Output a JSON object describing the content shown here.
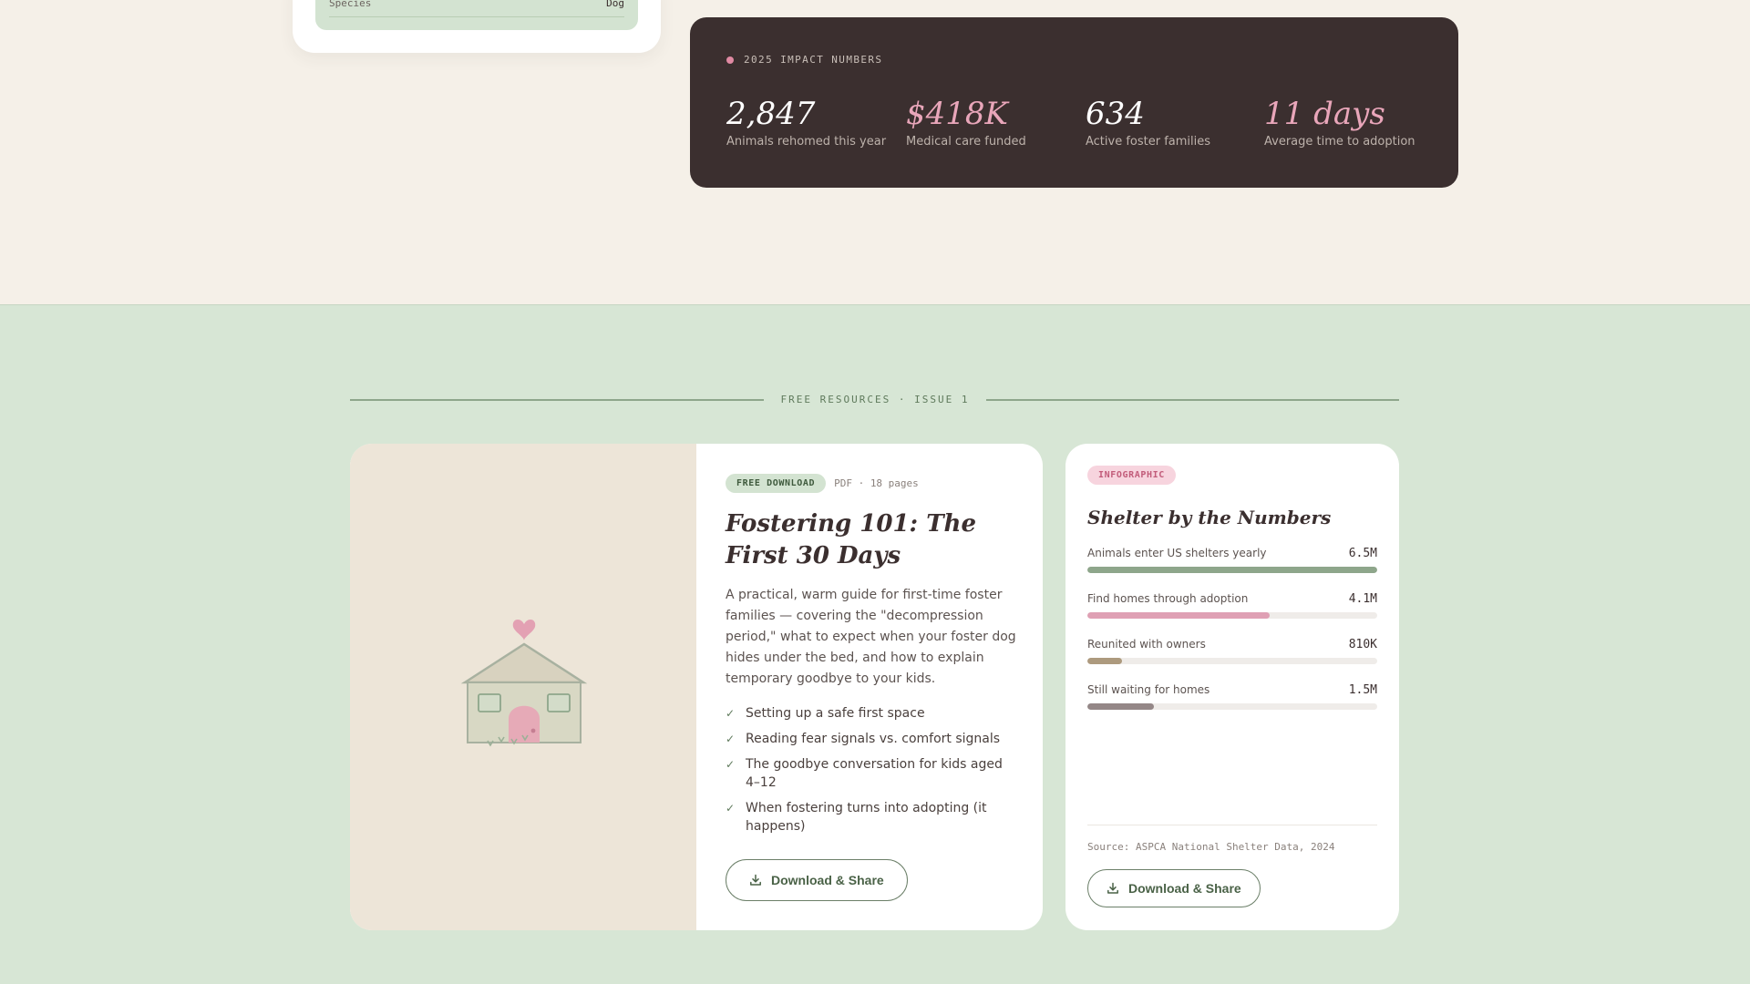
{
  "profile": {
    "species_label": "Species",
    "species_value": "Dog"
  },
  "impact": {
    "heading": "2025 IMPACT NUMBERS",
    "stats": [
      {
        "value": "2,847",
        "label": "Animals rehomed this year",
        "color": "#ffffff"
      },
      {
        "value": "$418K",
        "label": "Medical care funded",
        "color": "#e9a6ba"
      },
      {
        "value": "634",
        "label": "Active foster families",
        "color": "#ffffff"
      },
      {
        "value": "11 days",
        "label": "Average time to adoption",
        "color": "#e9a6ba"
      }
    ]
  },
  "resources": {
    "heading": "FREE RESOURCES · ISSUE 1",
    "guide": {
      "badge": "FREE DOWNLOAD",
      "meta": "PDF · 18 pages",
      "title": "Fostering 101: The First 30 Days",
      "description": "A practical, warm guide for first-time foster families — covering the \"decompression period,\" what to expect when your foster dog hides under the bed, and how to explain temporary goodbye to your kids.",
      "checklist": [
        "Setting up a safe first space",
        "Reading fear signals vs. comfort signals",
        "The goodbye conversation for kids aged 4–12",
        "When fostering turns into adopting (it happens)"
      ],
      "button_label": "Download & Share",
      "icons": {
        "art": "house-heart-illustration",
        "check": "check-icon",
        "download": "download-icon"
      }
    },
    "infographic": {
      "badge": "INFOGRAPHIC",
      "title": "Shelter by the Numbers",
      "rows": [
        {
          "label": "Animals enter US shelters yearly",
          "value": "6.5M",
          "fraction": 1.0,
          "color": "#8ea68b"
        },
        {
          "label": "Find homes through adoption",
          "value": "4.1M",
          "fraction": 0.63,
          "color": "#dfa0b4"
        },
        {
          "label": "Reunited with owners",
          "value": "810K",
          "fraction": 0.12,
          "color": "#ad9a7e"
        },
        {
          "label": "Still waiting for homes",
          "value": "1.5M",
          "fraction": 0.23,
          "color": "#948787"
        }
      ],
      "source": "Source: ASPCA National Shelter Data, 2024",
      "button_label": "Download & Share"
    }
  },
  "colors": {
    "cream": "#f5f0e8",
    "sage": "#d7e6d5",
    "dark": "#3b2f2f",
    "pink": "#e08aa3",
    "green_text": "#4a6247"
  }
}
